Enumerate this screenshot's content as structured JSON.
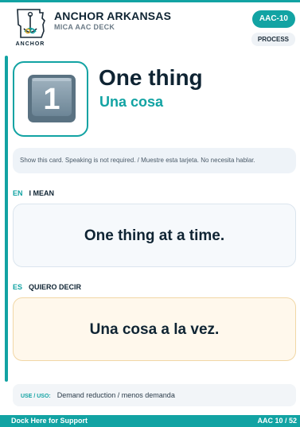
{
  "header": {
    "logo_text": "ANCHOR",
    "brand": "ANCHOR ARKANSAS",
    "deck": "MICA AAC DECK",
    "code": "AAC-10",
    "category": "PROCESS"
  },
  "card": {
    "icon": "keycap-digit-one-icon",
    "title_en": "One thing",
    "title_es": "Una cosa"
  },
  "notice": "Show this card. Speaking is not required. / Muestre esta tarjeta. No necesita hablar.",
  "english": {
    "lang": "EN",
    "heading": "I MEAN",
    "phrase": "One thing at a time."
  },
  "spanish": {
    "lang": "ES",
    "heading": "QUIERO DECIR",
    "phrase": "Una cosa a la vez."
  },
  "use": {
    "label": "USE / USO:",
    "text": "Demand reduction / menos demanda"
  },
  "footer": {
    "support": "Dock Here for Support",
    "page": "AAC 10 / 52"
  },
  "colors": {
    "accent": "#12a3a3",
    "navy": "#0f2433",
    "es_box": "#fff8ec"
  }
}
